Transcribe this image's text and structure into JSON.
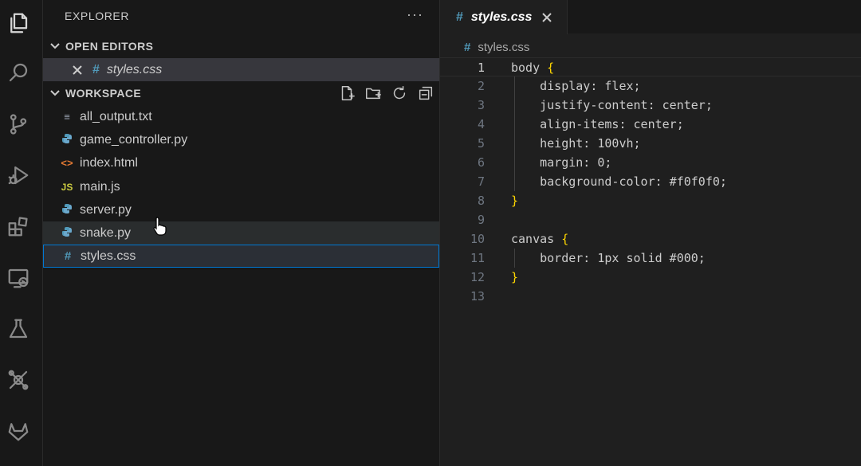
{
  "explorer": {
    "title": "EXPLORER",
    "more": "···",
    "open_editors": {
      "label": "OPEN EDITORS",
      "items": [
        {
          "name": "styles.css",
          "icon": "#"
        }
      ]
    },
    "workspace": {
      "label": "WORKSPACE",
      "actions": [
        "new-file",
        "new-folder",
        "refresh",
        "collapse-all"
      ],
      "files": [
        {
          "name": "all_output.txt",
          "icon": "≡",
          "icon_color": "#9da5b4"
        },
        {
          "name": "game_controller.py",
          "icon": "python",
          "icon_color": "#519aba"
        },
        {
          "name": "index.html",
          "icon": "<>",
          "icon_color": "#e37933"
        },
        {
          "name": "main.js",
          "icon": "JS",
          "icon_color": "#cbcb41"
        },
        {
          "name": "server.py",
          "icon": "python",
          "icon_color": "#519aba"
        },
        {
          "name": "snake.py",
          "icon": "python",
          "icon_color": "#519aba"
        },
        {
          "name": "styles.css",
          "icon": "#",
          "icon_color": "#519aba"
        }
      ],
      "selected_file": "styles.css",
      "hovered_file": "snake.py"
    }
  },
  "editor": {
    "tab": {
      "name": "styles.css",
      "icon": "#"
    },
    "breadcrumb": {
      "name": "styles.css",
      "icon": "#"
    },
    "current_line": 1,
    "lines": [
      {
        "n": "1",
        "text": "body {"
      },
      {
        "n": "2",
        "text": "    display: flex;"
      },
      {
        "n": "3",
        "text": "    justify-content: center;"
      },
      {
        "n": "4",
        "text": "    align-items: center;"
      },
      {
        "n": "5",
        "text": "    height: 100vh;"
      },
      {
        "n": "6",
        "text": "    margin: 0;"
      },
      {
        "n": "7",
        "text": "    background-color: #f0f0f0;"
      },
      {
        "n": "8",
        "text": "}"
      },
      {
        "n": "9",
        "text": ""
      },
      {
        "n": "10",
        "text": "canvas {"
      },
      {
        "n": "11",
        "text": "    border: 1px solid #000;"
      },
      {
        "n": "12",
        "text": "}"
      },
      {
        "n": "13",
        "text": ""
      }
    ]
  },
  "colors": {
    "accent": "#0078d4",
    "css_icon": "#519aba",
    "brace": "#ffd700"
  }
}
